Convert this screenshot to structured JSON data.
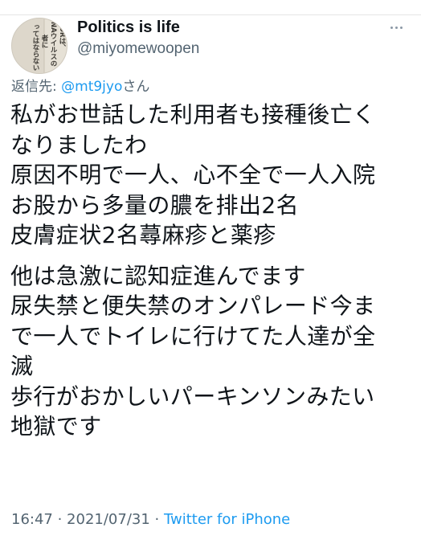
{
  "tweet": {
    "author": {
      "display_name": "Politics is life",
      "handle": "@miyomewoopen",
      "avatar_text": [
        "DRは、",
        "NAウイルスの",
        "者に",
        "ってはならない"
      ]
    },
    "reply_to": {
      "prefix": "返信先: ",
      "mention": "@mt9jyo",
      "suffix": "さん"
    },
    "paragraphs": [
      [
        "私がお世話した利用者も接種後亡く",
        "なりましたわ",
        "原因不明で一人、心不全で一人入院",
        "お股から多量の膿を排出2名",
        "皮膚症状2名蕁麻疹と薬疹"
      ],
      [
        "他は急激に認知症進んでます",
        "尿失禁と便失禁のオンパレード今ま",
        "で一人でトイレに行けてた人達が全",
        "滅",
        "歩行がおかしいパーキンソンみたい",
        "地獄です"
      ]
    ],
    "meta": {
      "time": "16:47",
      "separator": " · ",
      "date": "2021/07/31",
      "source": "Twitter for iPhone"
    }
  },
  "colors": {
    "text": "#0f1419",
    "secondary": "#536471",
    "link": "#1d9bf0"
  },
  "icons": {
    "more": "more-horizontal-icon"
  }
}
